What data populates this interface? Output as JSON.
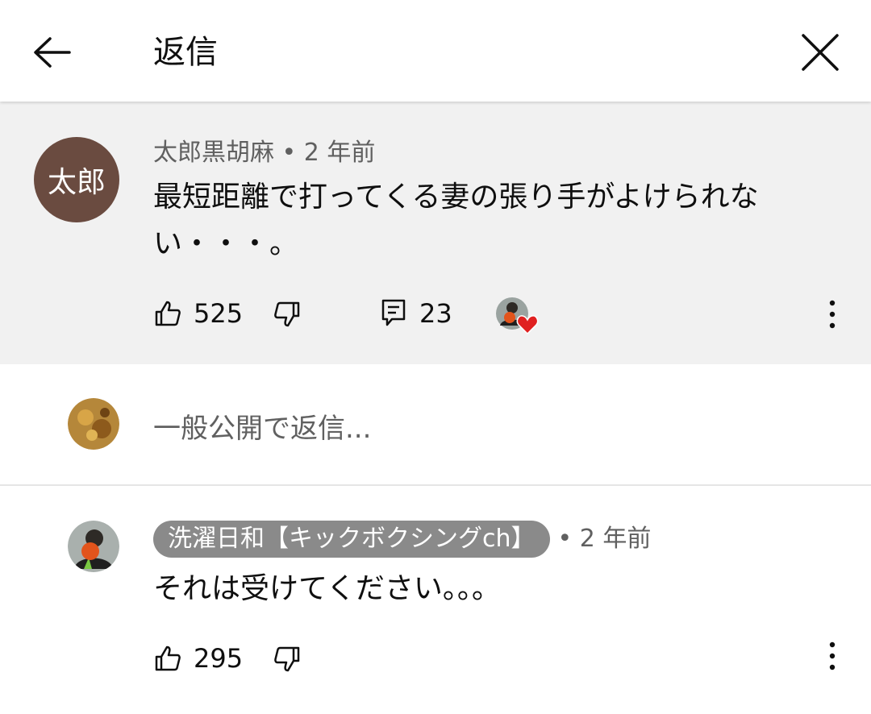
{
  "header": {
    "title": "返信"
  },
  "parent_comment": {
    "avatar_text": "太郎",
    "author": "太郎黒胡麻",
    "time": "• 2 年前",
    "text_line1": "最短距離で打ってくる妻の張り手がよけられな",
    "text_line2": "い・・・。",
    "likes": "525",
    "replies": "23"
  },
  "reply_input": {
    "placeholder": "一般公開で返信..."
  },
  "reply": {
    "author": "洗濯日和【キックボクシングch】",
    "time": "• 2 年前",
    "text": "それは受けてください。。。",
    "likes": "295"
  },
  "colors": {
    "heart": "#e02020",
    "avatar_bg": "#6a4b40",
    "badge_bg": "#8a8a8a"
  }
}
